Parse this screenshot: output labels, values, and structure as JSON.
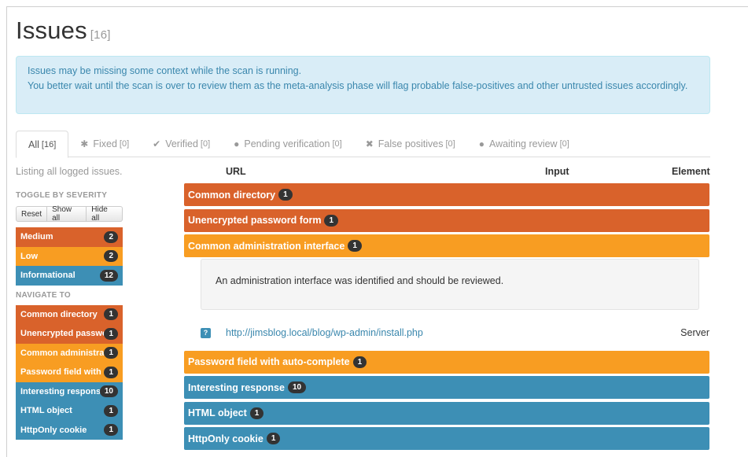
{
  "header": {
    "title": "Issues",
    "count": "[16]"
  },
  "alert": {
    "line1": "Issues may be missing some context while the scan is running.",
    "line2": "You better wait until the scan is over to review them as the meta-analysis phase will flag probable false-positives and other untrusted issues accordingly."
  },
  "tabs": [
    {
      "label": "All",
      "count": "[16]",
      "icon": "",
      "active": true
    },
    {
      "label": "Fixed",
      "count": "[0]",
      "icon": "✱"
    },
    {
      "label": "Verified",
      "count": "[0]",
      "icon": "✔"
    },
    {
      "label": "Pending verification",
      "count": "[0]",
      "icon": "●"
    },
    {
      "label": "False positives",
      "count": "[0]",
      "icon": "✖"
    },
    {
      "label": "Awaiting review",
      "count": "[0]",
      "icon": "●"
    }
  ],
  "listing": "Listing all logged issues.",
  "columns": {
    "url": "URL",
    "input": "Input",
    "element": "Element"
  },
  "sidebar": {
    "toggle_heading": "TOGGLE BY SEVERITY",
    "buttons": {
      "reset": "Reset",
      "show_all": "Show all",
      "hide_all": "Hide all"
    },
    "severities": [
      {
        "label": "Medium",
        "count": "2",
        "color": "#d9622b"
      },
      {
        "label": "Low",
        "count": "2",
        "color": "#f89d22"
      },
      {
        "label": "Informational",
        "count": "12",
        "color": "#3d8fb5"
      }
    ],
    "navigate_heading": "NAVIGATE TO",
    "navigate": [
      {
        "label": "Common directory",
        "count": "1",
        "severity": "medium"
      },
      {
        "label": "Unencrypted password form",
        "count": "1",
        "severity": "medium"
      },
      {
        "label": "Common administration interfa",
        "count": "1",
        "severity": "low"
      },
      {
        "label": "Password field with auto-compl",
        "count": "1",
        "severity": "low"
      },
      {
        "label": "Interesting response",
        "count": "10",
        "severity": "info"
      },
      {
        "label": "HTML object",
        "count": "1",
        "severity": "info"
      },
      {
        "label": "HttpOnly cookie",
        "count": "1",
        "severity": "info"
      }
    ]
  },
  "issues": [
    {
      "title": "Common directory",
      "count": "1",
      "severity": "medium"
    },
    {
      "title": "Unencrypted password form",
      "count": "1",
      "severity": "medium"
    },
    {
      "title": "Common administration interface",
      "count": "1",
      "severity": "low",
      "expanded": {
        "description": "An administration interface was identified and should be reviewed.",
        "url": "http://jimsblog.local/blog/wp-admin/install.php",
        "element": "Server"
      }
    },
    {
      "title": "Password field with auto-complete",
      "count": "1",
      "severity": "low"
    },
    {
      "title": "Interesting response",
      "count": "10",
      "severity": "info"
    },
    {
      "title": "HTML object",
      "count": "1",
      "severity": "info"
    },
    {
      "title": "HttpOnly cookie",
      "count": "1",
      "severity": "info"
    }
  ],
  "colors": {
    "medium": "#d9622b",
    "low": "#f89d22",
    "info": "#3d8fb5"
  }
}
